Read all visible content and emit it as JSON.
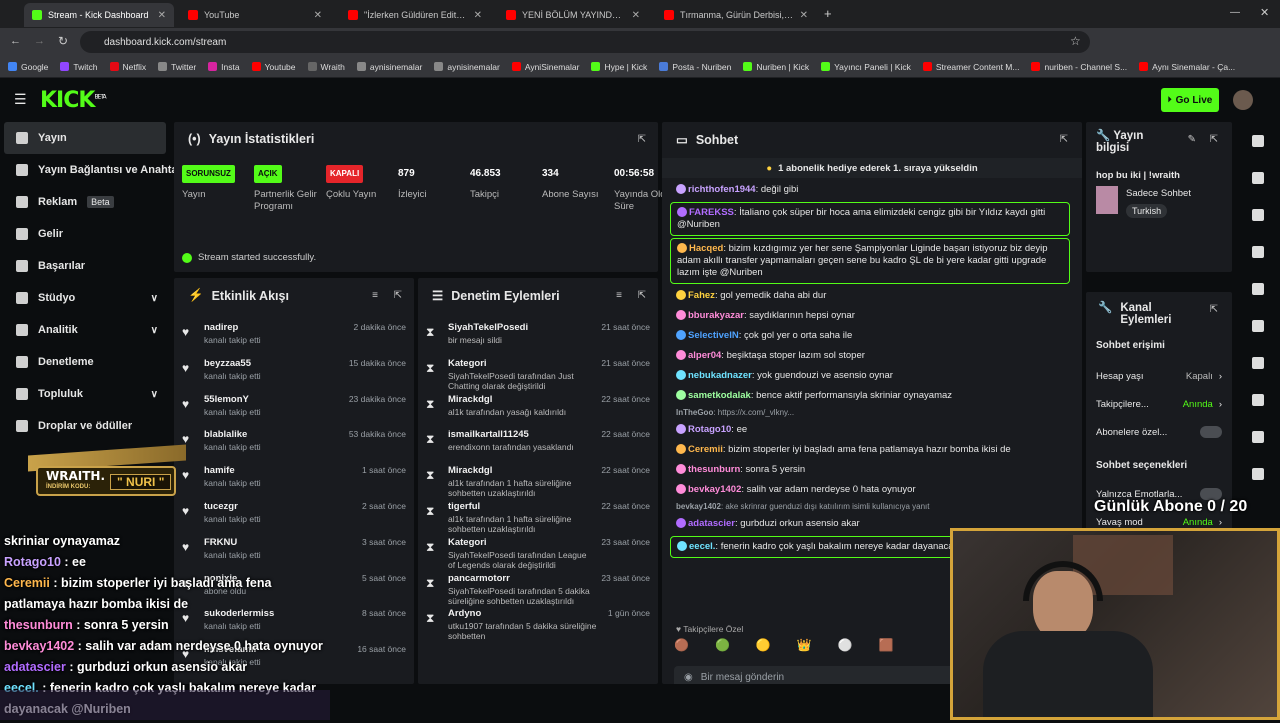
{
  "browser": {
    "tabs": [
      {
        "title": "Stream - Kick Dashboard",
        "color": "#53fc18"
      },
      {
        "title": "YouTube",
        "color": "#ff0000"
      },
      {
        "title": "\"İzlerken Güldüren Edit\" Kick &",
        "color": "#ff0000"
      },
      {
        "title": "YENİ BÖLÜM YAYINDA 🚨 @Ol",
        "color": "#ff0000"
      },
      {
        "title": "Tırmanma, Gürün Derbisi, Yüksı",
        "color": "#ff0000"
      }
    ],
    "url": "dashboard.kick.com/stream",
    "bookmarks": [
      "Google",
      "Twitch",
      "Netflix",
      "Twitter",
      "Insta",
      "Youtube",
      "Wraith",
      "aynisinemalar",
      "aynisinemalar",
      "AyniSinemalar",
      "Hype | Kick",
      "Posta - Nuriben",
      "Nuriben | Kick",
      "Yayıncı Paneli | Kick",
      "Streamer Content M...",
      "nuriben - Channel S...",
      "Aynı Sinemalar - Ça..."
    ]
  },
  "header": {
    "logo": "KICK",
    "beta": "BETA",
    "go_live": "Go Live"
  },
  "sidebar": [
    {
      "label": "Yayın",
      "active": true
    },
    {
      "label": "Yayın Bağlantısı ve Anahtar"
    },
    {
      "label": "Reklam",
      "badge": "Beta"
    },
    {
      "label": "Gelir"
    },
    {
      "label": "Başarılar"
    },
    {
      "label": "Stüdyo",
      "chevron": "∨"
    },
    {
      "label": "Analitik",
      "chevron": "∨"
    },
    {
      "label": "Denetleme"
    },
    {
      "label": "Topluluk",
      "chevron": "∨"
    },
    {
      "label": "Droplar ve ödüller"
    }
  ],
  "stats": {
    "title": "Yayın İstatistikleri",
    "items": [
      {
        "value": "SORUNSUZ",
        "label": "Yayın",
        "badge": "#53fc18"
      },
      {
        "value": "AÇIK",
        "label": "Partnerlik Gelir Programı",
        "badge": "#53fc18"
      },
      {
        "value": "KAPALI",
        "label": "Çoklu Yayın",
        "badge": "#e5252a"
      },
      {
        "value": "879",
        "label": "İzleyici"
      },
      {
        "value": "46.853",
        "label": "Takipçi"
      },
      {
        "value": "334",
        "label": "Abone Sayısı"
      },
      {
        "value": "00:56:58",
        "label": "Yayında Olduğu Süre"
      }
    ],
    "status": "Stream started successfully."
  },
  "activity": {
    "title": "Etkinlik Akışı",
    "items": [
      {
        "name": "nadirep",
        "sub": "kanalı takip etti",
        "time": "2 dakika önce"
      },
      {
        "name": "beyzzaa55",
        "sub": "kanalı takip etti",
        "time": "15 dakika önce"
      },
      {
        "name": "55lemonY",
        "sub": "kanalı takip etti",
        "time": "23 dakika önce"
      },
      {
        "name": "blablalike",
        "sub": "kanalı takip etti",
        "time": "53 dakika önce"
      },
      {
        "name": "hamife",
        "sub": "kanalı takip etti",
        "time": "1 saat önce"
      },
      {
        "name": "tucezgr",
        "sub": "kanalı takip etti",
        "time": "2 saat önce"
      },
      {
        "name": "FRKNU",
        "sub": "kanalı takip etti",
        "time": "3 saat önce"
      },
      {
        "name": "nonixie",
        "sub": "abone oldu",
        "time": "5 saat önce"
      },
      {
        "name": "sukoderlermiss",
        "sub": "kanalı takip etti",
        "time": "8 saat önce"
      },
      {
        "name": "mnsvefamil",
        "sub": "kanalı takip etti",
        "time": "16 saat önce"
      }
    ]
  },
  "moderation": {
    "title": "Denetim Eylemleri",
    "items": [
      {
        "name": "SiyahTekelPosedi",
        "sub": "bir mesajı sildi",
        "time": "21 saat önce"
      },
      {
        "name": "Kategori",
        "sub": "SiyahTekelPosedi tarafından Just Chatting olarak değiştirildi",
        "time": "21 saat önce"
      },
      {
        "name": "Mirackdgl",
        "sub": "al1k tarafından yasağı kaldırıldı",
        "time": "22 saat önce"
      },
      {
        "name": "ismailkartall11245",
        "sub": "erendixonn tarafından yasaklandı",
        "time": "22 saat önce"
      },
      {
        "name": "Mirackdgl",
        "sub": "al1k tarafından 1 hafta süreliğine sohbetten uzaklaştırıldı",
        "time": "22 saat önce"
      },
      {
        "name": "tigerful",
        "sub": "al1k tarafından 1 hafta süreliğine sohbetten uzaklaştırıldı",
        "time": "22 saat önce"
      },
      {
        "name": "Kategori",
        "sub": "SiyahTekelPosedi tarafından League of Legends olarak değiştirildi",
        "time": "23 saat önce"
      },
      {
        "name": "pancarmotorr",
        "sub": "SiyahTekelPosedi tarafından 5 dakika süreliğine sohbetten uzaklaştırıldı",
        "time": "23 saat önce"
      },
      {
        "name": "Ardyno",
        "sub": "utku1907 tarafından 5 dakika süreliğine sohbetten",
        "time": "1 gün önce"
      }
    ]
  },
  "chat": {
    "title": "Sohbet",
    "pinned": "1 abonelik hediye ederek 1. sıraya yükseldin",
    "messages": [
      {
        "user": "richthofen1944",
        "color": "#c8a2ff",
        "text": "değil gibi"
      },
      {
        "user": "FAREKSS",
        "color": "#b16cff",
        "text": "İtaliano çok süper bir hoca ama elimizdeki cengiz gibi bir Yıldız kaydı gitti @Nuriben",
        "hl": true
      },
      {
        "user": "Hacqed",
        "color": "#ffb84d",
        "text": "bizim kızdıgımız yer her sene Şampiyonlar Liginde başarı istiyoruz biz deyip adam akıllı transfer yapmamaları geçen sene bu kadro ŞL de bi yere kadar gitti upgrade lazım işte @Nuriben",
        "hl": true
      },
      {
        "user": "Fahez",
        "color": "#ffd23f",
        "text": "gol yemedik daha abi dur"
      },
      {
        "user": "bburakyazar",
        "color": "#ff8cd9",
        "text": "saydıklarının hepsi oynar"
      },
      {
        "user": "SelectiveIN",
        "color": "#4fa3ff",
        "text": "çok gol yer o orta saha ile"
      },
      {
        "user": "alper04",
        "color": "#ff8cd9",
        "text": "beşiktaşa stoper lazım sol stoper"
      },
      {
        "user": "nebukadnazer",
        "color": "#6fe3ff",
        "text": "yok guendouzi ve asensio oynar"
      },
      {
        "user": "sametkodalak",
        "color": "#9effa0",
        "text": "bence aktif performansıyla skriniar oynayamaz"
      },
      {
        "user": "InTheGoo",
        "color": "#9aa0a6",
        "text": "https://x.com/_vlkny...",
        "reply": true
      },
      {
        "user": "Rotago10",
        "color": "#c8a2ff",
        "text": "ee"
      },
      {
        "user": "Ceremii",
        "color": "#ffb84d",
        "text": "bizim stoperler iyi başladı ama fena patlamaya hazır bomba ikisi de"
      },
      {
        "user": "thesunburn",
        "color": "#ff8cd9",
        "text": "sonra 5 yersin"
      },
      {
        "user": "bevkay1402",
        "color": "#ff8cd9",
        "text": "salih var adam nerdeyse 0 hata oynuyor"
      },
      {
        "user": "bevkay1402",
        "color": "#9aa0a6",
        "text": "ake skrinrar guenduzi dışı katıılırım isimli kullanıcıya yanıt",
        "reply": true
      },
      {
        "user": "adatascier",
        "color": "#b16cff",
        "text": "gurbduzi orkun asensio akar"
      },
      {
        "user": "eecel.",
        "color": "#6fe3ff",
        "text": "fenerin kadro çok yaşlı bakalım nereye kadar dayanacak",
        "hl": true
      }
    ],
    "follower_only": "Takipçilere Özel",
    "input_placeholder": "Bir mesaj gönderin",
    "bottom_count": "0"
  },
  "info": {
    "title": "Yayın bilgisi",
    "stream_title": "hop bu iki | !wraith",
    "category": "Sadece Sohbet",
    "tag": "Turkish"
  },
  "channel_actions": {
    "title": "Kanal Eylemleri",
    "chat_access": "Sohbet erişimi",
    "rows": [
      {
        "label": "Hesap yaşı",
        "value": "Kapalı"
      },
      {
        "label": "Takipçilere...",
        "value": "Anında",
        "green": true
      },
      {
        "label": "Abonelere özel...",
        "toggle": true
      }
    ],
    "chat_options": "Sohbet seçenekleri",
    "rows2": [
      {
        "label": "Yalnızca Emotlarla...",
        "toggle": true
      },
      {
        "label": "Yavaş mod",
        "value": "Anında",
        "green": true
      }
    ]
  },
  "overlay": {
    "promo": "WRAITH. NURI",
    "promo_code_label": "İNDİRİM KODU:",
    "sub_goal": "Günlük Abone 0 / 20",
    "chat_lines": [
      {
        "user": "",
        "text": "skriniar oynayamaz",
        "color": "#ffffff"
      },
      {
        "user": "Rotago10",
        "text": " : ee",
        "color": "#c8a2ff"
      },
      {
        "user": "Ceremii",
        "text": " : bizim stoperler iyi başladı ama fena",
        "color": "#ffb84d"
      },
      {
        "user": "",
        "text": "patlamaya hazır bomba ikisi de",
        "color": "#ffffff"
      },
      {
        "user": "thesunburn",
        "text": " : sonra 5 yersin",
        "color": "#ff8cd9"
      },
      {
        "user": "bevkay1402",
        "text": " : salih var adam nerdeyse 0 hata oynuyor",
        "color": "#ff8cd9"
      },
      {
        "user": "adatascier",
        "text": " : gurbduzi orkun asensio akar",
        "color": "#b16cff"
      },
      {
        "user": "eecel.",
        "text": " : fenerin kadro çok yaşlı bakalım nereye kadar",
        "color": "#6fe3ff"
      },
      {
        "user": "",
        "text": "dayanacak @Nuriben",
        "color": "#ffffff"
      }
    ]
  }
}
